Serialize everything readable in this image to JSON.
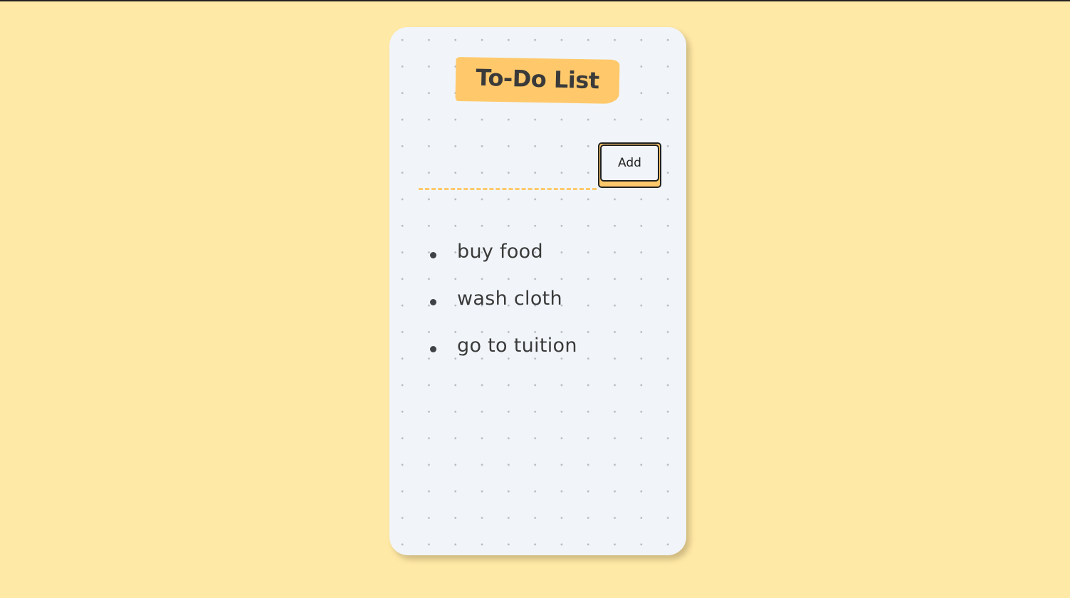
{
  "app": {
    "title": "To-Do List"
  },
  "form": {
    "input_value": "",
    "input_placeholder": "",
    "add_label": "Add"
  },
  "todos": [
    {
      "text": "buy food"
    },
    {
      "text": "wash cloth"
    },
    {
      "text": "go to tuition"
    }
  ],
  "colors": {
    "page_background": "#ffe9a6",
    "card_background": "#f1f5f9",
    "accent": "#ffc96b",
    "text": "#3a3a3a"
  }
}
